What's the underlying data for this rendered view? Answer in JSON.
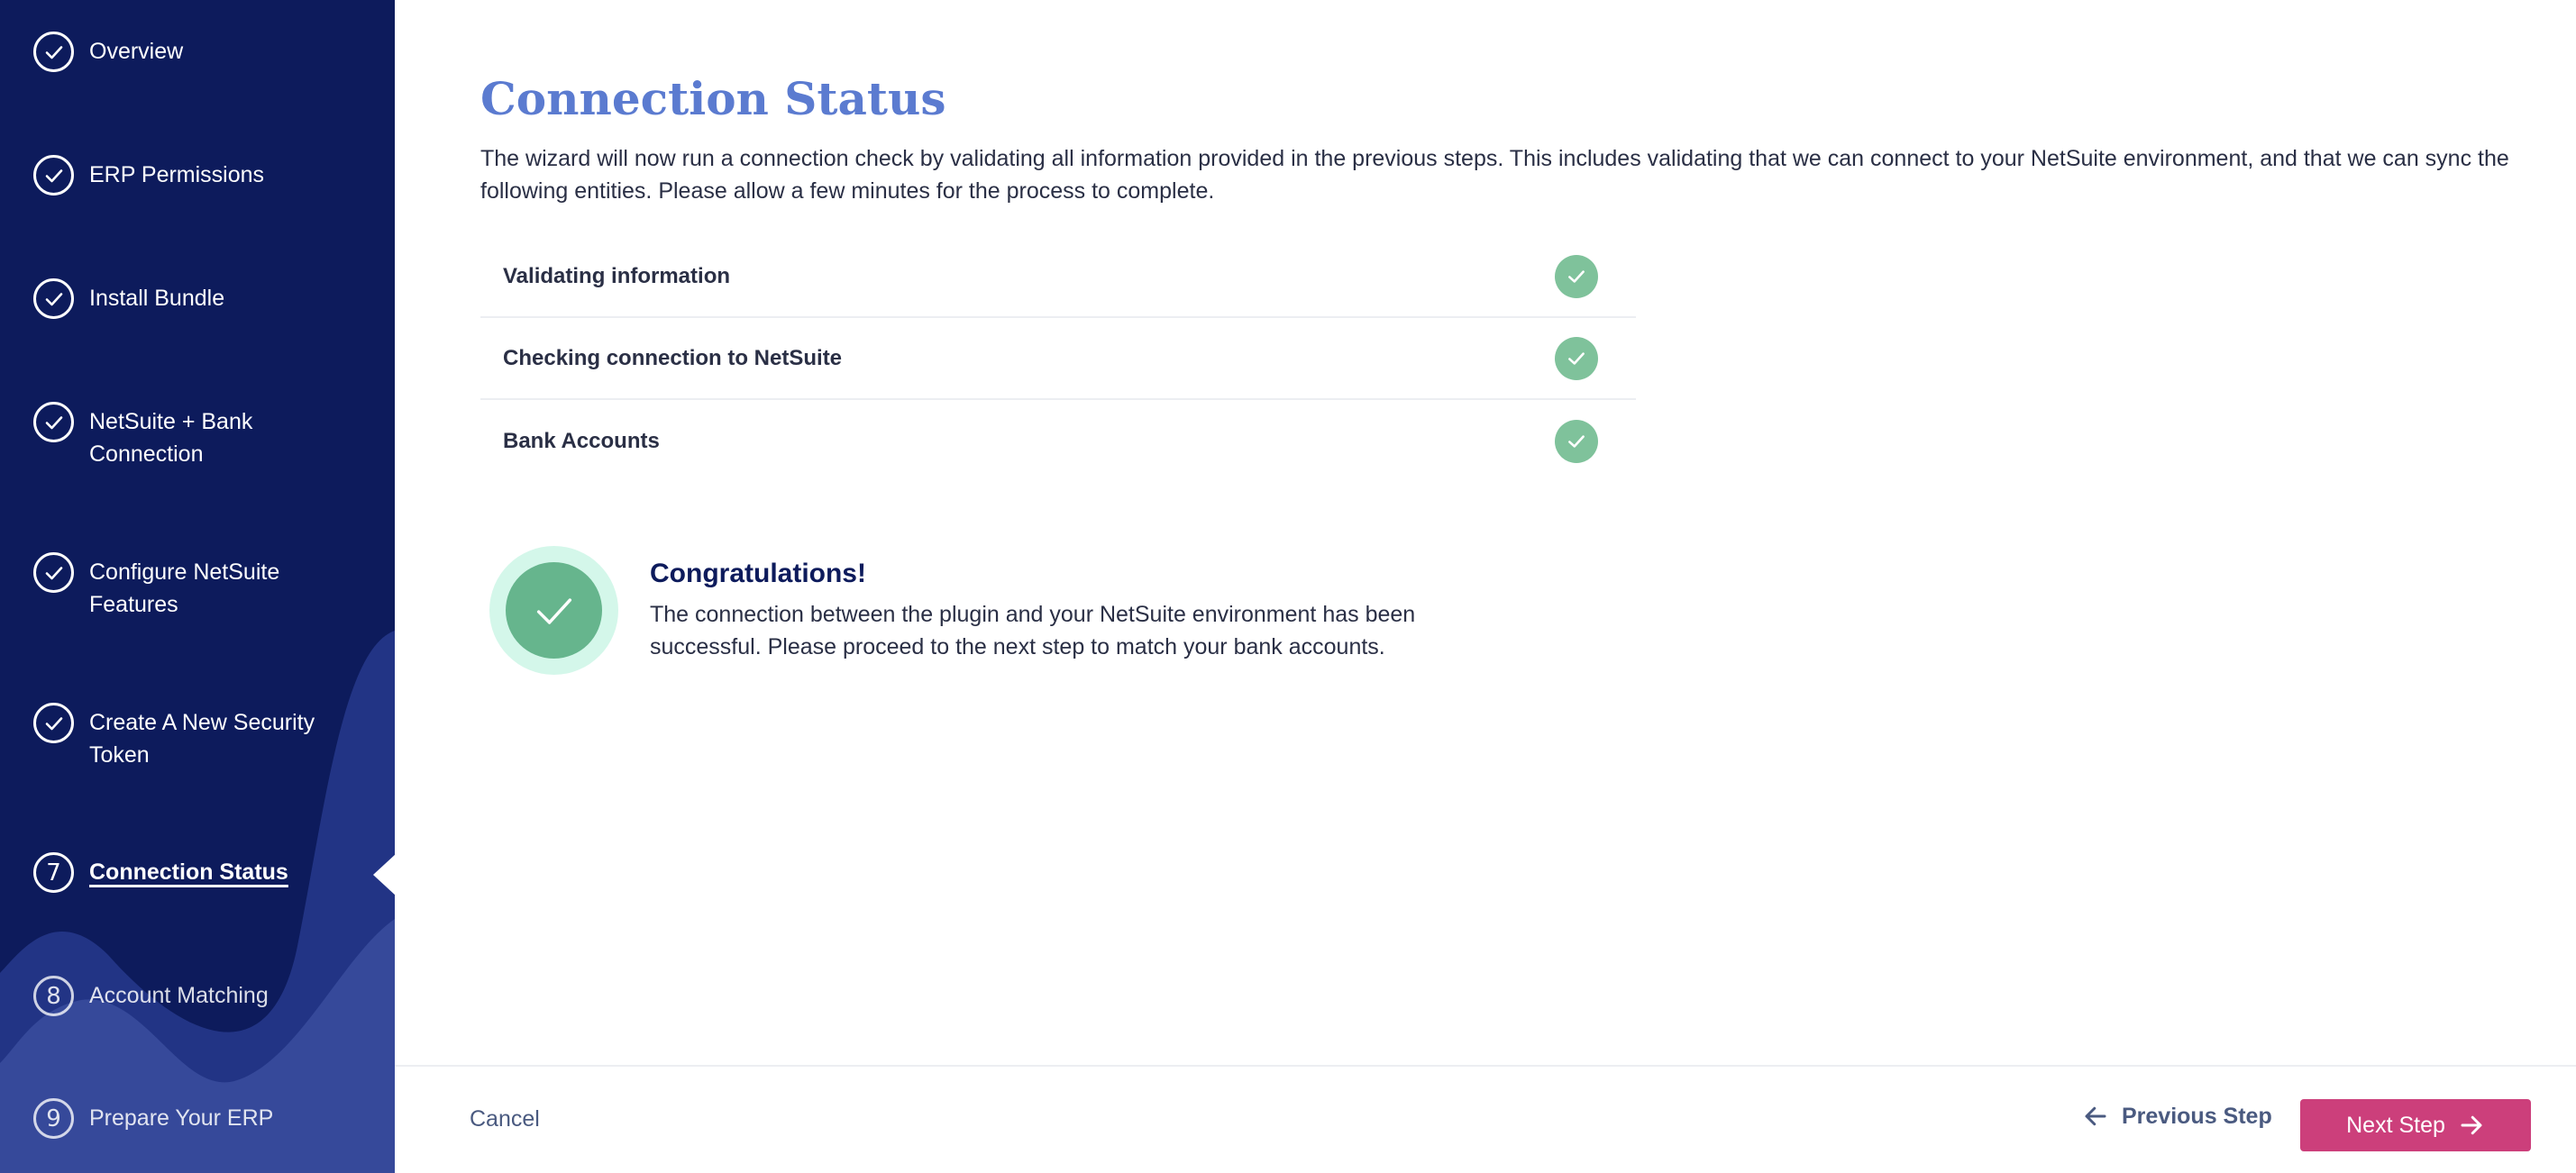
{
  "sidebar": {
    "steps": [
      {
        "label": "Overview",
        "state": "done"
      },
      {
        "label": "ERP Permissions",
        "state": "done"
      },
      {
        "label": "Install Bundle",
        "state": "done"
      },
      {
        "label": "NetSuite + Bank Connection",
        "state": "done"
      },
      {
        "label": "Configure NetSuite Features",
        "state": "done"
      },
      {
        "label": "Create A New Security Token",
        "state": "done"
      },
      {
        "label": "Connection Status",
        "number": "7",
        "state": "active"
      },
      {
        "label": "Account Matching",
        "number": "8",
        "state": "future"
      },
      {
        "label": "Prepare Your ERP",
        "number": "9",
        "state": "future"
      }
    ]
  },
  "main": {
    "title": "Connection Status",
    "intro": "The wizard will now run a connection check by validating all information provided in the previous steps. This includes validating that we can connect to your NetSuite environment, and that we can sync the following entities. Please allow a few minutes for the process to complete.",
    "checks": [
      {
        "label": "Validating information",
        "status": "success"
      },
      {
        "label": "Checking connection to NetSuite",
        "status": "success"
      },
      {
        "label": "Bank Accounts",
        "status": "success"
      }
    ],
    "success": {
      "title": "Congratulations!",
      "body": "The connection between the plugin and your NetSuite environment has been successful. Please proceed to the next step to match your bank accounts."
    }
  },
  "footer": {
    "cancel_label": "Cancel",
    "previous_label": "Previous Step",
    "next_label": "Next Step"
  },
  "colors": {
    "sidebar_bg": "#0d1b5c",
    "title": "#5b7bd0",
    "success_green": "#7fc29b",
    "primary_button": "#cc3f7b"
  },
  "icons": {
    "done": "check-icon",
    "status": "check-circle-icon",
    "back": "arrow-left-icon",
    "forward": "arrow-right-icon"
  }
}
